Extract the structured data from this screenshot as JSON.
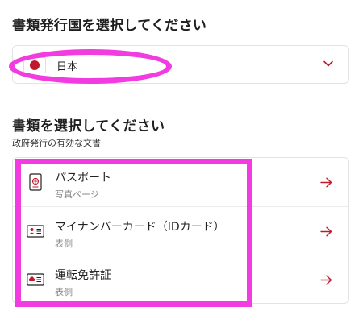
{
  "country_section": {
    "heading": "書類発行国を選択してください",
    "selected_country": "日本",
    "flag_icon": "japan-flag-icon",
    "chevron_icon": "chevron-down-icon"
  },
  "document_section": {
    "heading": "書類を選択してください",
    "subheading": "政府発行の有効な文書",
    "items": [
      {
        "title": "パスポート",
        "subtitle": "写真ページ",
        "icon": "passport-icon"
      },
      {
        "title": "マイナンバーカード（IDカード）",
        "subtitle": "表側",
        "icon": "id-card-icon"
      },
      {
        "title": "運転免許証",
        "subtitle": "表側",
        "icon": "drivers-license-icon"
      }
    ],
    "arrow_icon": "arrow-right-icon"
  },
  "colors": {
    "highlight": "#f23ce1",
    "accent": "#c0182b",
    "border": "#e3e3e3"
  }
}
